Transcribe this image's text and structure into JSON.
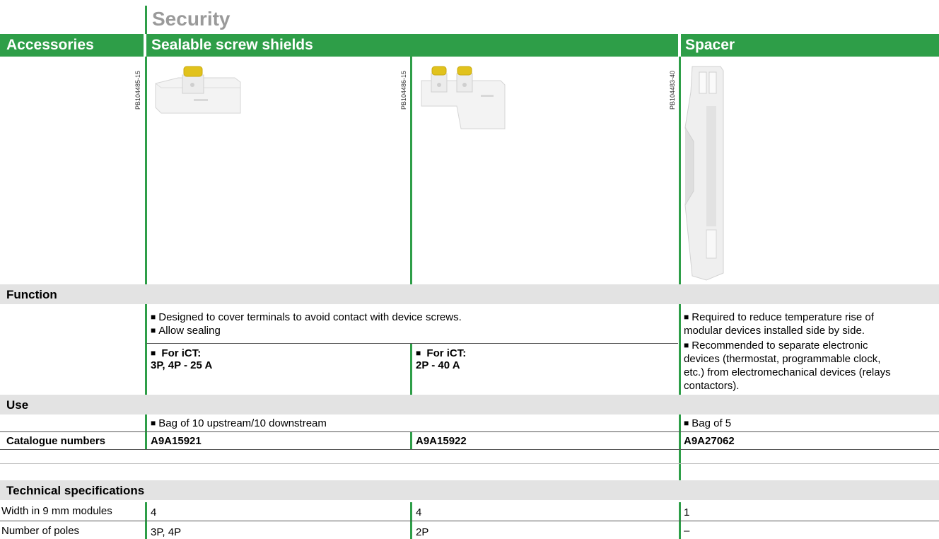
{
  "section_title": "Security",
  "header": {
    "col1": "Accessories",
    "col2": "Sealable screw shields",
    "col4": "Spacer"
  },
  "image_refs": {
    "img1": "PB104485-15",
    "img2": "PB104486-15",
    "img3": "PB104483-40"
  },
  "function": {
    "heading": "Function",
    "shields_line1": "Designed to cover terminals to avoid contact with device screws.",
    "shields_line2": "Allow sealing",
    "shield1_for": "For iCT:",
    "shield1_spec": "3P, 4P - 25 A",
    "shield2_for": "For iCT:",
    "shield2_spec": "2P - 40 A",
    "spacer_p1_l1": "Required to reduce temperature rise of",
    "spacer_p1_l2": "modular devices installed side by side.",
    "spacer_p2_l1": "Recommended to separate electronic",
    "spacer_p2_l2": "devices (thermostat, programmable clock,",
    "spacer_p2_l3": "etc.) from electromechanical devices (relays",
    "spacer_p2_l4": "contactors)."
  },
  "use": {
    "heading": "Use",
    "shields": "Bag of 10 upstream/10 downstream",
    "spacer": "Bag of 5"
  },
  "catalogue": {
    "label": "Catalogue numbers",
    "n1": "A9A15921",
    "n2": "A9A15922",
    "n3": "A9A27062"
  },
  "technical": {
    "heading": "Technical specifications",
    "rows": [
      {
        "label": "Width in 9 mm modules",
        "v1": "4",
        "v2": "4",
        "v3": "1"
      },
      {
        "label": "Number of poles",
        "v1": "3P, 4P",
        "v2": "2P",
        "v3": "–"
      }
    ]
  },
  "colors": {
    "accent": "#2e9e48",
    "section_bg": "#e3e3e3",
    "title_gray": "#9a9a9a"
  }
}
